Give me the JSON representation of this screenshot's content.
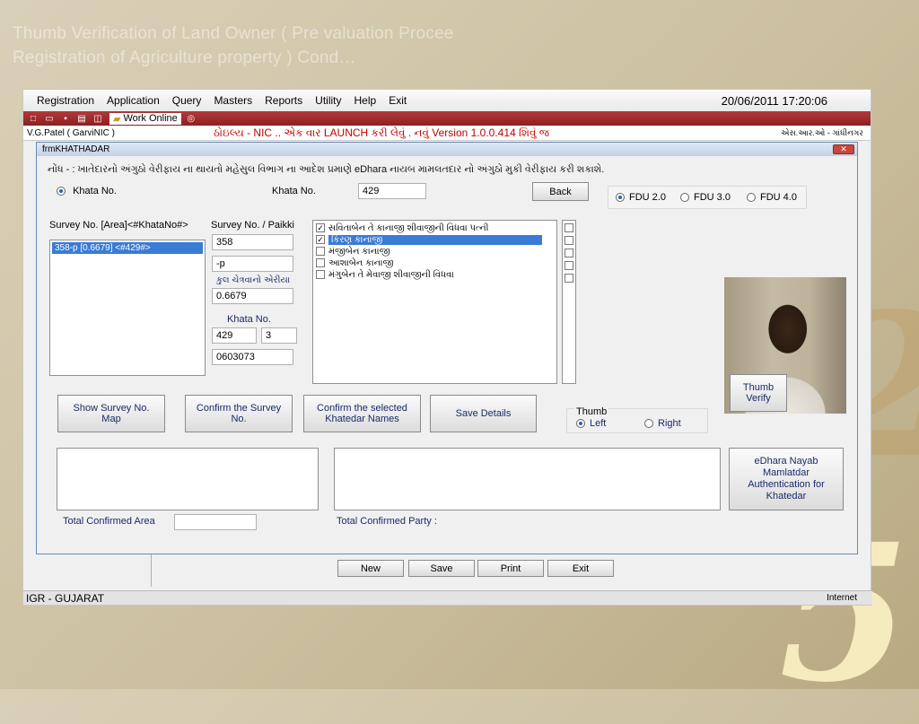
{
  "slide": {
    "title_line1": "Thumb Verification of Land Owner ( Pre valuation Procee",
    "title_line2": "Registration of Agriculture property ) Cond…",
    "deco_1": "2",
    "deco_2": "5"
  },
  "menubar": {
    "items": [
      "Registration",
      "Application",
      "Query",
      "Masters",
      "Reports",
      "Utility",
      "Help",
      "Exit"
    ],
    "datetime": "20/06/2011 17:20:06"
  },
  "toolbar": {
    "work_online": "Work Online"
  },
  "infobar": {
    "user": "V.G.Patel ( GarviNIC )",
    "launch_msg": "ઠોઇલ્ય  - NIC .. એક વાર LAUNCH  કરી લેવું . નવું Version 1.0.0.414  શિવું જ",
    "office": "એસ.આર.ઓ - ગાંધીનગર"
  },
  "form": {
    "title": "frmKHATHADAR",
    "close_label": "✕",
    "note": "નોંધ - : ખાતેદારનો અંગુઠો વેરીફાય ના થાયતો મહેસુલ વિભાગ ના આદેશ પ્રમાણે eDhara નાયબ  મામલતદાર નો અંગુઠો મુકી વેરીફાય કરી શકાશે.",
    "radio_khata_label": "Khata No.",
    "khata_label": "Khata No.",
    "khata_value": "429",
    "back_button": "Back",
    "fdu_options": [
      "FDU 2.0",
      "FDU 3.0",
      "FDU 4.0"
    ],
    "survey_list_header": "Survey No. [Area]<#KhataNo#>",
    "survey_list_items": [
      "358-p [0.6679] <#429#>"
    ],
    "survey_paikki_label": "Survey No. / Paikki",
    "survey_no": "358",
    "paikki": "-p",
    "area_label": "કુલ ચેત્રવાનો એરીયા",
    "area_value": "0.6679",
    "khata_no_label": "Khata No.",
    "khata_no_value": "429",
    "khata_sub_value": "3",
    "code_value": "0603073",
    "owners": [
      {
        "name": "સવિતાબેન તે કાનાજી શીવાજીની વિધવા પત્ની",
        "checked": true,
        "selected": false
      },
      {
        "name": "કિરણ કાનાજી",
        "checked": true,
        "selected": true
      },
      {
        "name": "મંજીબેન કાનાજી",
        "checked": false,
        "selected": false
      },
      {
        "name": "આશાબેન કાનાજી",
        "checked": false,
        "selected": false
      },
      {
        "name": "મંગુબેન તે મેવાજી શીવાજીની વિધવા",
        "checked": false,
        "selected": false
      }
    ],
    "thumb_verify_button": "Thumb Verify",
    "show_survey_map_button": "Show Survey No. Map",
    "confirm_survey_button": "Confirm the Survey No.",
    "confirm_khatedar_button": "Confirm the selected Khatedar  Names",
    "save_details_button": "Save Details",
    "thumb_group_label": "Thumb",
    "thumb_left": "Left",
    "thumb_right": "Right",
    "edhara_button": "eDhara Nayab Mamlatdar Authentication for Khatedar",
    "total_area_label": "Total Confirmed Area",
    "total_party_label": "Total Confirmed Party :"
  },
  "bottom_buttons": {
    "new": "New",
    "save": "Save",
    "print": "Print",
    "exit": "Exit"
  },
  "statusbar": {
    "left": "IGR - GUJARAT",
    "right": "Internet"
  }
}
